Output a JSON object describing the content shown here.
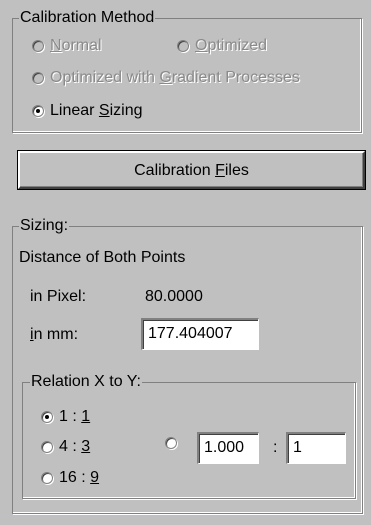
{
  "calibration_method": {
    "legend": "Calibration Method",
    "options": [
      {
        "label_pre": "",
        "label_key": "N",
        "label_post": "ormal",
        "checked": false,
        "enabled": false
      },
      {
        "label_pre": "",
        "label_key": "O",
        "label_post": "ptimized",
        "checked": false,
        "enabled": false
      },
      {
        "label_pre": "Optimized with ",
        "label_key": "G",
        "label_post": "radient Processes",
        "checked": false,
        "enabled": false
      },
      {
        "label_pre": "Linear ",
        "label_key": "S",
        "label_post": "izing",
        "checked": true,
        "enabled": true
      }
    ]
  },
  "calibration_files_button": {
    "label_pre": "Calibration ",
    "label_key": "F",
    "label_post": "iles"
  },
  "sizing": {
    "legend": "Sizing:",
    "distance_heading": "Distance of Both Points",
    "in_pixel_label": "in Pixel:",
    "in_pixel_value": "80.0000",
    "in_mm_label_key": "i",
    "in_mm_label_post": "n mm:",
    "in_mm_value": "177.404007",
    "relation": {
      "legend": "Relation X to Y:",
      "options": [
        {
          "label_pre": "1 : ",
          "label_key": "1",
          "checked": true
        },
        {
          "label_pre": "4 : ",
          "label_key": "3",
          "checked": false
        },
        {
          "label_pre": "16 : ",
          "label_key": "9",
          "checked": false
        }
      ],
      "custom": {
        "checked": false,
        "x_value": "1.000",
        "separator": ":",
        "y_value": "1"
      }
    }
  }
}
